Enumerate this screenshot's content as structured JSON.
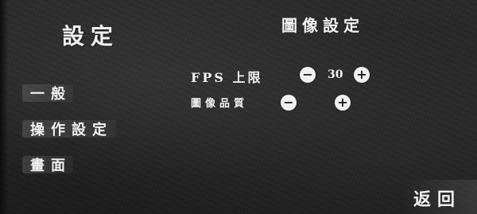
{
  "sidebar": {
    "title": "設定",
    "items": [
      {
        "label": "一般"
      },
      {
        "label": "操作設定"
      },
      {
        "label": "畫面"
      }
    ]
  },
  "panel": {
    "title": "圖像設定",
    "fps": {
      "label": "FPS 上限",
      "value": "30",
      "minus": "−",
      "plus": "+"
    },
    "quality": {
      "label": "圖像品質",
      "value": "",
      "minus": "−",
      "plus": "+"
    }
  },
  "footer": {
    "back_label": "返回"
  },
  "colors": {
    "background": "#262626",
    "text": "#f2f2f2",
    "button_fill": "#efefef"
  }
}
